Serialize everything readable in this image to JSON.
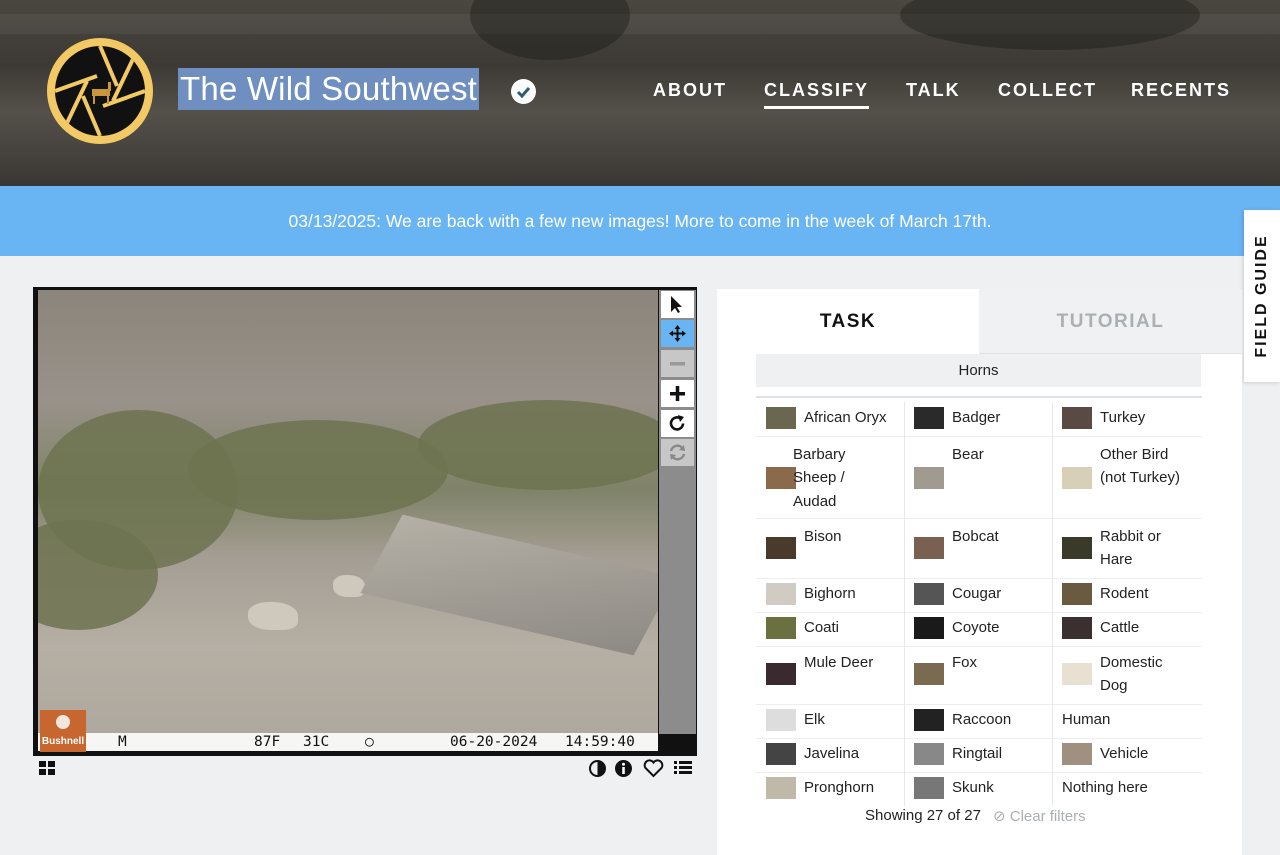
{
  "header": {
    "site_title": "The Wild Southwest",
    "nav": [
      {
        "label": "ABOUT"
      },
      {
        "label": "CLASSIFY",
        "active": true
      },
      {
        "label": "TALK"
      },
      {
        "label": "COLLECT"
      },
      {
        "label": "RECENTS"
      }
    ],
    "logo_colors": {
      "ring": "#f2c965",
      "inner": "#111111"
    }
  },
  "banner": {
    "text": "03/13/2025: We are back with a few new images! More to come in the week of March 17th."
  },
  "field_guide": {
    "label": "FIELD GUIDE"
  },
  "viewer": {
    "camera_brand": "Bushnell",
    "stamp": {
      "mode": "M",
      "temp_f": "87F",
      "temp_c": "31C",
      "date": "06-20-2024",
      "time": "14:59:40"
    },
    "tools": [
      {
        "icon": "pointer-icon"
      },
      {
        "icon": "move-icon",
        "active": true
      },
      {
        "icon": "zoom-out-icon",
        "disabled": true
      },
      {
        "icon": "zoom-in-icon"
      },
      {
        "icon": "rotate-icon"
      },
      {
        "icon": "reset-icon",
        "disabled": true
      }
    ]
  },
  "task": {
    "tabs": [
      "TASK",
      "TUTORIAL"
    ],
    "filter_label": "Horns",
    "choices": [
      [
        "African Oryx",
        "Badger",
        "Turkey"
      ],
      [
        "Barbary Sheep / Audad",
        "Bear",
        "Other Bird (not Turkey)"
      ],
      [
        "Bison",
        "Bobcat",
        "Rabbit or Hare"
      ],
      [
        "Bighorn",
        "Cougar",
        "Rodent"
      ],
      [
        "Coati",
        "Coyote",
        "Cattle"
      ],
      [
        "Mule Deer",
        "Fox",
        "Domestic Dog"
      ],
      [
        "Elk",
        "Raccoon",
        "Human"
      ],
      [
        "Javelina",
        "Ringtail",
        "Vehicle"
      ],
      [
        "Pronghorn",
        "Skunk",
        "Nothing here"
      ]
    ],
    "showing": "Showing 27 of 27",
    "clear_filters": "Clear filters"
  },
  "colors": {
    "banner": "#69b4f3",
    "active_tool": "#69b4f3"
  }
}
